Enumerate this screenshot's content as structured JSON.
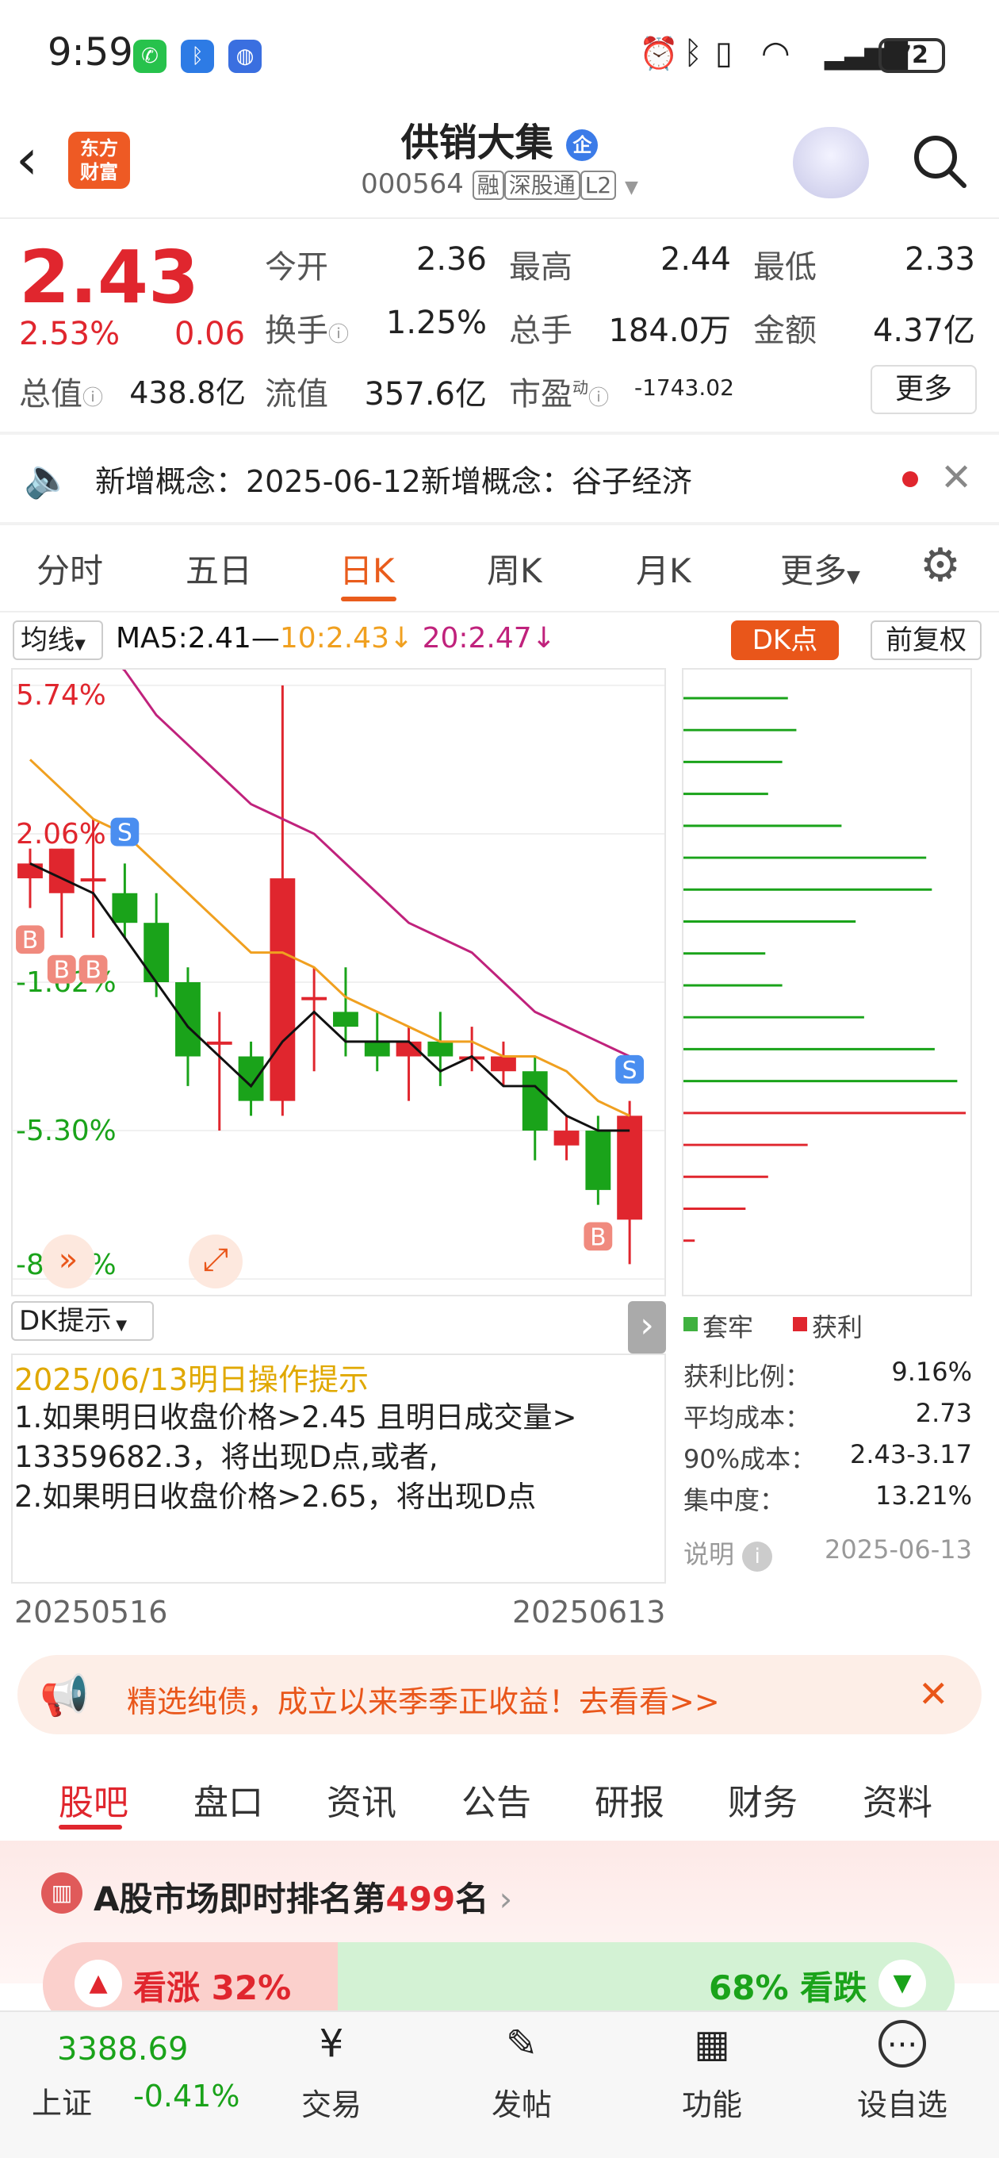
{
  "status_bar": {
    "time": "9:59",
    "battery": "72"
  },
  "header": {
    "logo_line1": "东方",
    "logo_line2": "财富",
    "stock_name": "供销大集",
    "badge": "企",
    "code": "000564",
    "tags": [
      "融",
      "深股通",
      "L2"
    ]
  },
  "quote": {
    "price": "2.43",
    "pct": "2.53%",
    "chg": "0.06",
    "fields": [
      {
        "label": "今开",
        "value": "2.36",
        "color": "green"
      },
      {
        "label": "最高",
        "value": "2.44",
        "color": "red"
      },
      {
        "label": "最低",
        "value": "2.33",
        "color": "green"
      },
      {
        "label": "换手",
        "value": "1.25%",
        "color": "normal"
      },
      {
        "label": "总手",
        "value": "184.0万",
        "color": "normal"
      },
      {
        "label": "金额",
        "value": "4.37亿",
        "color": "normal"
      },
      {
        "label": "总值",
        "value": "438.8亿",
        "color": "normal"
      },
      {
        "label": "流值",
        "value": "357.6亿",
        "color": "normal"
      },
      {
        "label": "市盈",
        "value": "-1743.02",
        "color": "normal"
      }
    ],
    "pe_super": "动",
    "more_label": "更多"
  },
  "news": {
    "text": "新增概念：2025-06-12新增概念：谷子经济"
  },
  "tabs": [
    "分时",
    "五日",
    "日K",
    "周K",
    "月K",
    "更多"
  ],
  "chart_toolbar": {
    "ma_select": "均线",
    "ma5": "MA5:2.41",
    "ma10": "10:2.43",
    "ma20": "20:2.47",
    "dk_button": "DK点",
    "adjust_button": "前复权"
  },
  "chart_data": {
    "type": "candlestick",
    "y_labels": [
      "5.74%",
      "2.06%",
      "-1.62%",
      "-5.30%",
      "-8.98%"
    ],
    "x_range": [
      "20250516",
      "20250613"
    ],
    "candles": [
      {
        "o": 2.59,
        "h": 2.61,
        "l": 2.57,
        "c": 2.6
      },
      {
        "o": 2.58,
        "h": 2.61,
        "l": 2.55,
        "c": 2.61
      },
      {
        "o": 2.59,
        "h": 2.63,
        "l": 2.55,
        "c": 2.59
      },
      {
        "o": 2.58,
        "h": 2.6,
        "l": 2.55,
        "c": 2.56
      },
      {
        "o": 2.56,
        "h": 2.58,
        "l": 2.51,
        "c": 2.52
      },
      {
        "o": 2.52,
        "h": 2.53,
        "l": 2.45,
        "c": 2.47
      },
      {
        "o": 2.48,
        "h": 2.5,
        "l": 2.42,
        "c": 2.48
      },
      {
        "o": 2.47,
        "h": 2.48,
        "l": 2.43,
        "c": 2.44
      },
      {
        "o": 2.44,
        "h": 2.72,
        "l": 2.43,
        "c": 2.59
      },
      {
        "o": 2.51,
        "h": 2.53,
        "l": 2.46,
        "c": 2.51
      },
      {
        "o": 2.5,
        "h": 2.53,
        "l": 2.47,
        "c": 2.49
      },
      {
        "o": 2.48,
        "h": 2.5,
        "l": 2.46,
        "c": 2.47
      },
      {
        "o": 2.47,
        "h": 2.49,
        "l": 2.44,
        "c": 2.48
      },
      {
        "o": 2.48,
        "h": 2.5,
        "l": 2.45,
        "c": 2.47
      },
      {
        "o": 2.47,
        "h": 2.49,
        "l": 2.46,
        "c": 2.47
      },
      {
        "o": 2.46,
        "h": 2.48,
        "l": 2.45,
        "c": 2.47
      },
      {
        "o": 2.46,
        "h": 2.47,
        "l": 2.4,
        "c": 2.42
      },
      {
        "o": 2.41,
        "h": 2.43,
        "l": 2.4,
        "c": 2.42
      },
      {
        "o": 2.42,
        "h": 2.43,
        "l": 2.37,
        "c": 2.38
      },
      {
        "o": 2.36,
        "h": 2.44,
        "l": 2.33,
        "c": 2.43
      }
    ],
    "ma5": [
      2.6,
      2.59,
      2.58,
      2.55,
      2.52,
      2.49,
      2.47,
      2.45,
      2.48,
      2.5,
      2.48,
      2.48,
      2.48,
      2.46,
      2.47,
      2.45,
      2.45,
      2.43,
      2.42,
      2.42
    ],
    "ma10": [
      2.67,
      2.65,
      2.63,
      2.62,
      2.6,
      2.58,
      2.56,
      2.54,
      2.54,
      2.53,
      2.51,
      2.5,
      2.49,
      2.48,
      2.48,
      2.47,
      2.47,
      2.46,
      2.44,
      2.43
    ],
    "ma20": [
      2.8,
      2.78,
      2.75,
      2.73,
      2.7,
      2.68,
      2.66,
      2.64,
      2.63,
      2.62,
      2.6,
      2.58,
      2.56,
      2.55,
      2.54,
      2.52,
      2.5,
      2.49,
      2.48,
      2.47
    ],
    "markers": [
      {
        "label": "S",
        "candle": 3
      },
      {
        "label": "B",
        "candle": 0
      },
      {
        "label": "B",
        "candle": 1
      },
      {
        "label": "B",
        "candle": 2
      },
      {
        "label": "S",
        "candle": 19
      },
      {
        "label": "B",
        "candle": 18
      }
    ],
    "chip_bars": [
      {
        "value": 0.37,
        "type": "loss"
      },
      {
        "value": 0.4,
        "type": "loss"
      },
      {
        "value": 0.35,
        "type": "loss"
      },
      {
        "value": 0.3,
        "type": "loss"
      },
      {
        "value": 0.56,
        "type": "loss"
      },
      {
        "value": 0.86,
        "type": "loss"
      },
      {
        "value": 0.88,
        "type": "loss"
      },
      {
        "value": 0.61,
        "type": "loss"
      },
      {
        "value": 0.29,
        "type": "loss"
      },
      {
        "value": 0.35,
        "type": "loss"
      },
      {
        "value": 0.64,
        "type": "loss"
      },
      {
        "value": 0.89,
        "type": "loss"
      },
      {
        "value": 0.97,
        "type": "loss"
      },
      {
        "value": 1.0,
        "type": "profit"
      },
      {
        "value": 0.44,
        "type": "profit"
      },
      {
        "value": 0.3,
        "type": "profit"
      },
      {
        "value": 0.22,
        "type": "profit"
      },
      {
        "value": 0.04,
        "type": "profit"
      }
    ]
  },
  "dk_hint": {
    "select": "DK提示",
    "title": "2025/06/13明日操作提示",
    "lines": [
      "    1.如果明日收盘价格>2.45 且明日成交量>",
      "13359682.3，将出现D点,或者,",
      "    2.如果明日收盘价格>2.65，将出现D点"
    ]
  },
  "chip_stats": {
    "legend_loss": "套牢",
    "legend_profit": "获利",
    "rows": [
      {
        "label": "获利比例：",
        "value": "9.16%"
      },
      {
        "label": "平均成本：",
        "value": "2.73"
      },
      {
        "label": "90%成本：",
        "value": "2.43-3.17"
      },
      {
        "label": "集中度：",
        "value": "13.21%"
      }
    ],
    "note_label": "说明",
    "date": "2025-06-13"
  },
  "promo": {
    "text": "精选纯债，成立以来季季正收益！去看看>>"
  },
  "section_tabs": [
    "股吧",
    "盘口",
    "资讯",
    "公告",
    "研报",
    "财务",
    "资料"
  ],
  "rank": {
    "prefix": "A股市场即时排名第",
    "number": "499",
    "suffix": "名"
  },
  "vote": {
    "up": "看涨 32%",
    "down": "68% 看跌"
  },
  "bottom_nav": {
    "index_value": "3388.69",
    "index_name": "上证",
    "index_change": "-0.41%",
    "items": [
      "交易",
      "发帖",
      "功能",
      "设自选"
    ]
  },
  "colors": {
    "up": "#e0262e",
    "down": "#1aa31a",
    "accent": "#e9561a",
    "ma5": "#111111",
    "ma10": "#f0a020",
    "ma20": "#c0227c"
  }
}
